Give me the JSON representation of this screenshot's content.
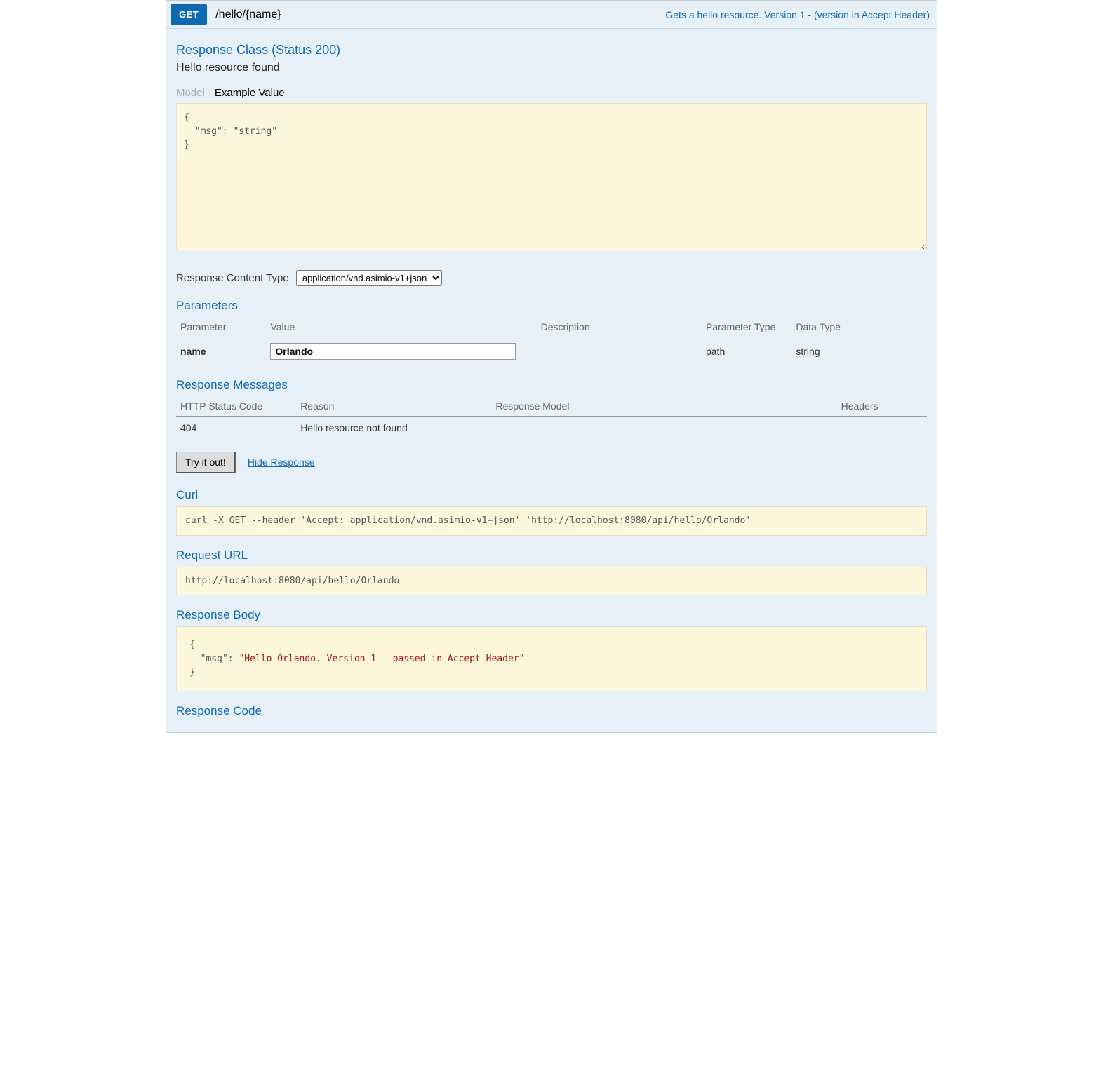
{
  "operation": {
    "method": "GET",
    "path": "/hello/{name}",
    "summary": "Gets a hello resource. Version 1 - (version in Accept Header)"
  },
  "response_class": {
    "title": "Response Class (Status 200)",
    "description": "Hello resource found",
    "tabs": {
      "model": "Model",
      "example": "Example Value"
    },
    "example_json": "{\n  \"msg\": \"string\"\n}"
  },
  "content_type": {
    "label": "Response Content Type",
    "options": [
      "application/vnd.asimio-v1+json"
    ],
    "selected": "application/vnd.asimio-v1+json"
  },
  "parameters": {
    "title": "Parameters",
    "headers": {
      "parameter": "Parameter",
      "value": "Value",
      "description": "Description",
      "parameter_type": "Parameter Type",
      "data_type": "Data Type"
    },
    "rows": [
      {
        "name": "name",
        "value": "Orlando",
        "description": "",
        "parameter_type": "path",
        "data_type": "string"
      }
    ]
  },
  "response_messages": {
    "title": "Response Messages",
    "headers": {
      "status": "HTTP Status Code",
      "reason": "Reason",
      "model": "Response Model",
      "headers": "Headers"
    },
    "rows": [
      {
        "status": "404",
        "reason": "Hello resource not found",
        "model": "",
        "headers": ""
      }
    ]
  },
  "actions": {
    "try_it_out": "Try it out!",
    "hide_response": "Hide Response"
  },
  "curl": {
    "title": "Curl",
    "command": "curl -X GET --header 'Accept: application/vnd.asimio-v1+json' 'http://localhost:8080/api/hello/Orlando'"
  },
  "request_url": {
    "title": "Request URL",
    "url": "http://localhost:8080/api/hello/Orlando"
  },
  "response_body": {
    "title": "Response Body",
    "json_html": "{\n  <span class=\"key\">\"msg\"</span>: <span class=\"str\">\"Hello Orlando. Version 1 - passed in Accept Header\"</span>\n}"
  },
  "response_code": {
    "title": "Response Code"
  }
}
